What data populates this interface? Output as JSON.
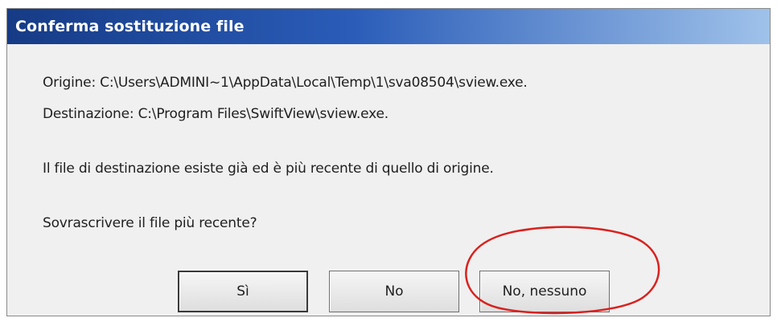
{
  "dialog": {
    "title": "Conferma sostituzione file",
    "origin_line": "Origine: C:\\Users\\ADMINI~1\\AppData\\Local\\Temp\\1\\sva08504\\sview.exe.",
    "destination_line": "Destinazione: C:\\Program Files\\SwiftView\\sview.exe.",
    "info_text": "Il file di destinazione esiste già ed è più recente di quello di origine.",
    "question_text": "Sovrascrivere il file più recente?",
    "buttons": {
      "yes": "Sì",
      "no": "No",
      "no_to_all": "No, nessuno"
    }
  },
  "colors": {
    "titlebar_start": "#163b86",
    "titlebar_end": "#9fc2ea",
    "dialog_bg": "#f0f0f0",
    "annotation_circle": "#d8221f"
  }
}
